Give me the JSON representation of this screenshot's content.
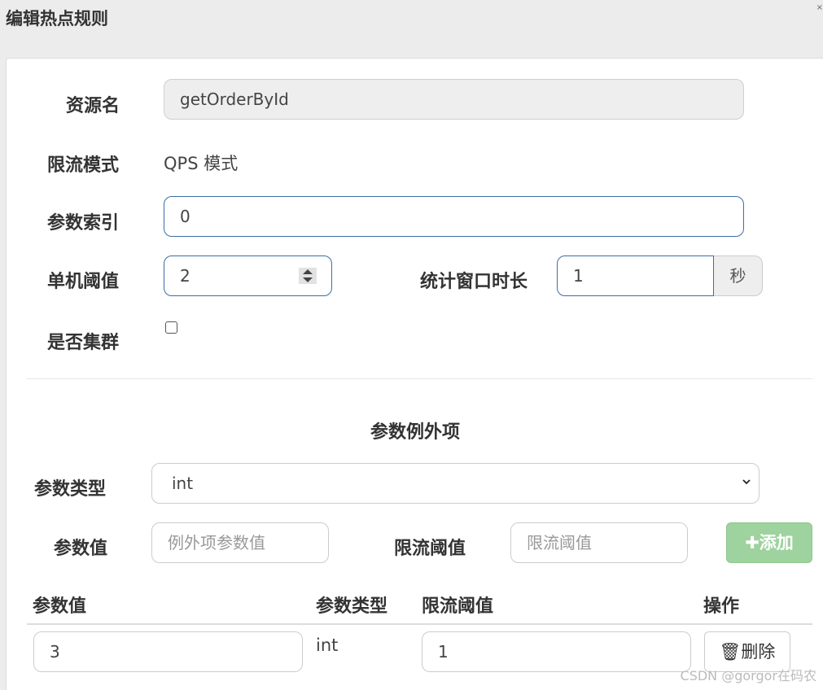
{
  "header": {
    "title": "编辑热点规则"
  },
  "form": {
    "resource_label": "资源名",
    "resource_value": "getOrderById",
    "mode_label": "限流模式",
    "mode_value": "QPS 模式",
    "param_index_label": "参数索引",
    "param_index_value": "0",
    "threshold_label": "单机阈值",
    "threshold_value": "2",
    "window_label": "统计窗口时长",
    "window_value": "1",
    "window_unit": "秒",
    "cluster_label": "是否集群",
    "cluster_checked": false
  },
  "exceptions": {
    "title": "参数例外项",
    "type_label": "参数类型",
    "type_selected": "int",
    "value_label": "参数值",
    "value_placeholder": "例外项参数值",
    "limit_label": "限流阈值",
    "limit_placeholder": "限流阈值",
    "add_label": "添加"
  },
  "table": {
    "headers": [
      "参数值",
      "参数类型",
      "限流阈值",
      "操作"
    ],
    "rows": [
      {
        "value": "3",
        "type": "int",
        "limit": "1",
        "action": "删除"
      }
    ]
  },
  "watermark": "CSDN @gorgor在码农",
  "icons": {
    "add": "plus-icon",
    "delete": "trash-icon",
    "select": "chevron-down-icon"
  }
}
